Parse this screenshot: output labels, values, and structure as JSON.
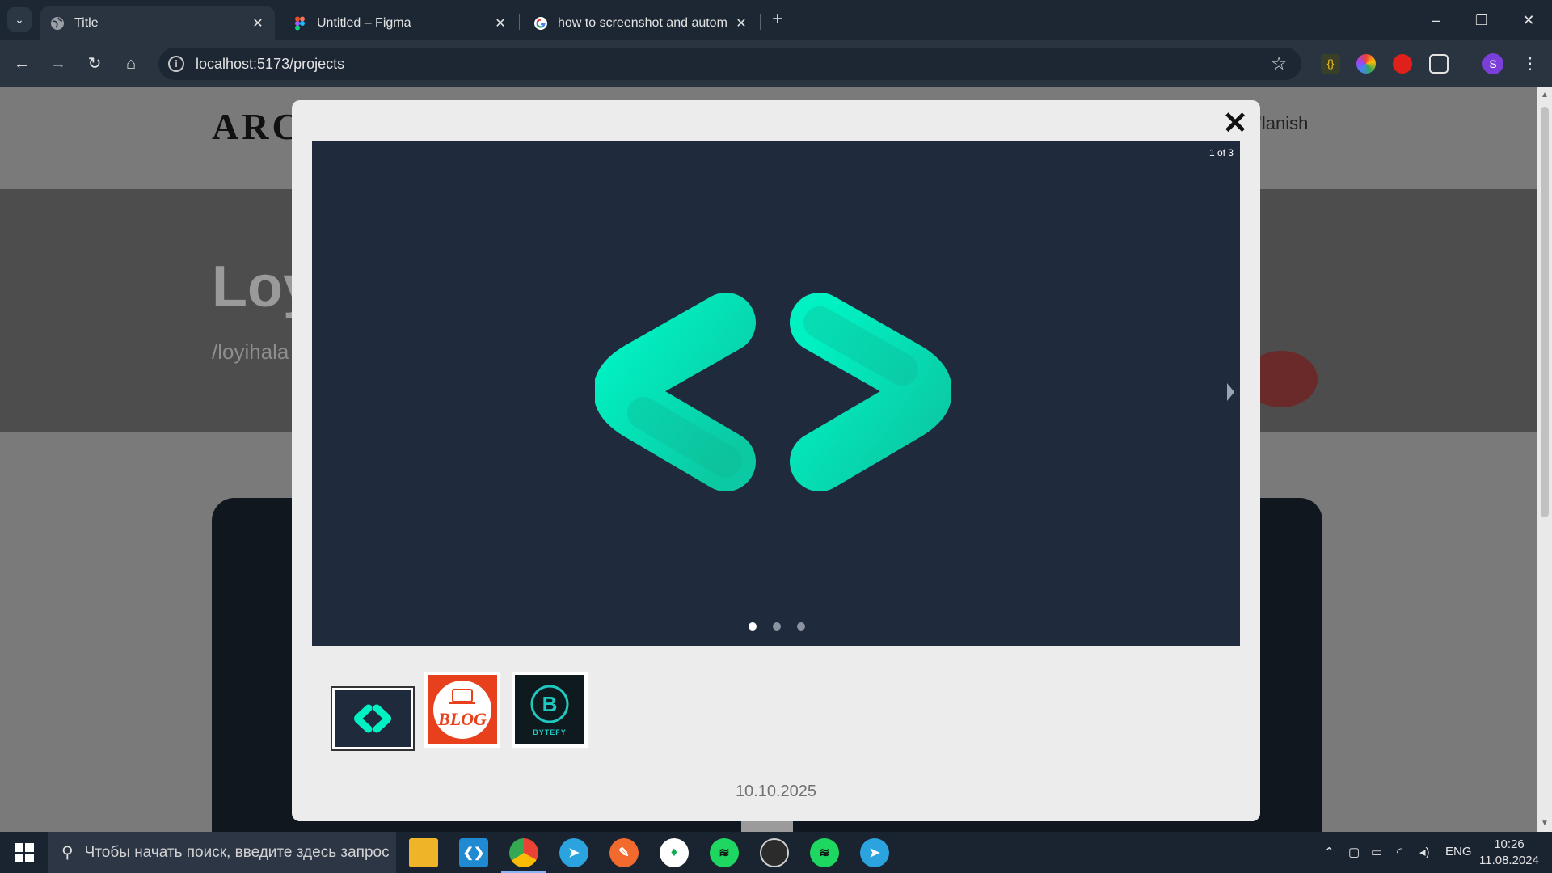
{
  "browser": {
    "tabs": [
      {
        "title": "Title",
        "icon": "globe-icon",
        "active": true
      },
      {
        "title": "Untitled – Figma",
        "icon": "figma-icon",
        "active": false
      },
      {
        "title": "how to screenshot and automat",
        "icon": "google-icon",
        "active": false
      }
    ],
    "new_tab": "+",
    "url": "localhost:5173/projects",
    "profile_initial": "S"
  },
  "page": {
    "logo": "ARC",
    "nav_partial": "’lanish",
    "hero_title": "Loy",
    "hero_path": "/loyihala"
  },
  "modal": {
    "close": "✕",
    "counter": "1 of 3",
    "slide_count": 3,
    "active_index": 0,
    "thumbnails": [
      {
        "label": "",
        "icon": "code-brackets-icon",
        "bg": "#1f2a3d"
      },
      {
        "label": "BLOG",
        "icon": "laptop-icon",
        "bg": "#e8401c"
      },
      {
        "label": "BYTEFY",
        "icon": "bytefy-b-icon",
        "bg": "#0f1a1f"
      }
    ],
    "date": "10.10.2025",
    "accent": "#00f2c3"
  },
  "taskbar": {
    "search_placeholder": "Чтобы начать поиск, введите здесь запрос",
    "language": "ENG",
    "time": "10:26",
    "date": "11.08.2024"
  }
}
